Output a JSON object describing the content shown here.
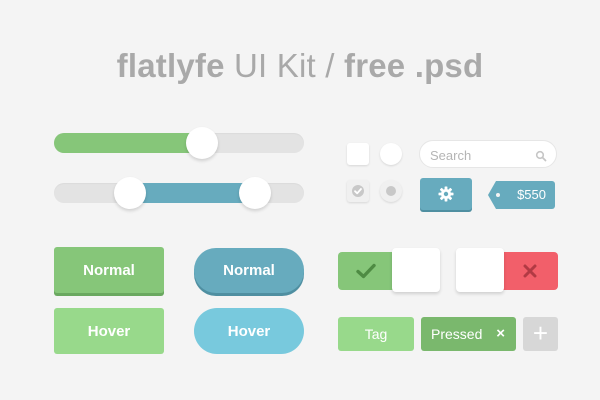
{
  "title": {
    "brand": "flatlyfe",
    "middle": "UI Kit /",
    "suffix": "free .psd"
  },
  "sliders": [
    {
      "type": "single",
      "value": 0.59,
      "color": "#86c679"
    },
    {
      "type": "range",
      "low": 0.3,
      "high": 0.8,
      "color": "#67abbe"
    }
  ],
  "checkboxes": [
    {
      "checked": false
    },
    {
      "checked": true,
      "icon": "check-icon"
    }
  ],
  "radios": [
    {
      "checked": false
    },
    {
      "checked": true
    }
  ],
  "search": {
    "placeholder": "Search",
    "icon": "search-icon"
  },
  "settings_button": {
    "icon": "gear-icon"
  },
  "price_tag": {
    "label": "$550"
  },
  "buttons": {
    "green_normal": "Normal",
    "green_hover": "Hover",
    "blue_normal": "Normal",
    "blue_hover": "Hover"
  },
  "toggles": [
    {
      "state": "on",
      "icon": "check-icon",
      "color": "#86c679"
    },
    {
      "state": "off",
      "icon": "close-icon",
      "color": "#f25f6a"
    }
  ],
  "tags": {
    "plain": "Tag",
    "pressed": "Pressed",
    "remove_glyph": "×",
    "add_glyph": "+"
  },
  "colors": {
    "green": "#86c679",
    "green_light": "#98d98b",
    "blue": "#67abbe",
    "blue_light": "#78c9dd",
    "red": "#f25f6a",
    "background": "#f4f4f4"
  }
}
